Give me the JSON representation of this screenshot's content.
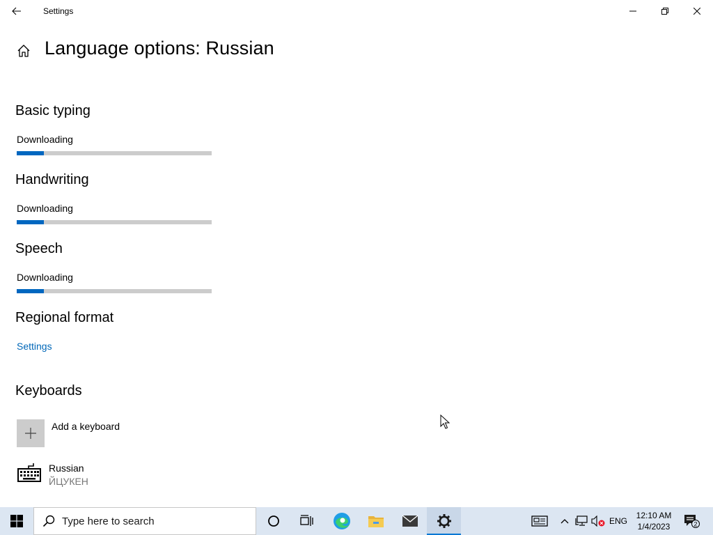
{
  "window": {
    "title": "Settings"
  },
  "page": {
    "title": "Language options: Russian"
  },
  "sections": {
    "basic_typing": {
      "heading": "Basic typing",
      "status": "Downloading",
      "progress": 0.14
    },
    "handwriting": {
      "heading": "Handwriting",
      "status": "Downloading",
      "progress": 0.14
    },
    "speech": {
      "heading": "Speech",
      "status": "Downloading",
      "progress": 0.14
    },
    "regional_format": {
      "heading": "Regional format",
      "link": "Settings"
    },
    "keyboards": {
      "heading": "Keyboards",
      "add_label": "Add a keyboard",
      "items": [
        {
          "name": "Russian",
          "layout": "ЙЦУКЕН"
        }
      ]
    }
  },
  "taskbar": {
    "search_placeholder": "Type here to search",
    "language": "ENG",
    "time": "12:10 AM",
    "date": "1/4/2023",
    "notification_count": "2"
  },
  "colors": {
    "accent": "#0067c0",
    "link": "#0067b8",
    "progress_track": "#cccccc",
    "taskbar": "#dce6f2"
  },
  "icons": {
    "back": "back-arrow-icon",
    "home": "home-icon",
    "add": "plus-icon",
    "keyboard": "keyboard-icon",
    "start": "windows-logo-icon",
    "search": "search-icon",
    "cortana": "cortana-icon",
    "task_view": "task-view-icon",
    "edge": "edge-icon",
    "explorer": "file-explorer-icon",
    "mail": "mail-icon",
    "settings": "gear-icon",
    "news": "news-icon",
    "show_hidden": "chevron-up-icon",
    "network": "network-icon",
    "volume": "volume-muted-icon",
    "notifications": "action-center-icon"
  }
}
